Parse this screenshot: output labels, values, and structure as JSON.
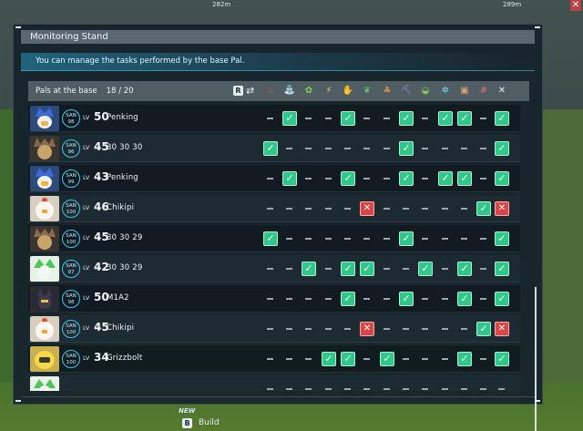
{
  "hud": {
    "distance_left": "282m",
    "distance_right": "289m",
    "close_glyph": "✕"
  },
  "window": {
    "title": "Monitoring Stand",
    "subtitle": "You can manage the tasks performed by the base Pal."
  },
  "list": {
    "title": "Pals at the base",
    "count": "18 / 20",
    "sort_key": "R",
    "swap_glyph": "⇄"
  },
  "work_icons": [
    {
      "name": "kindling-icon",
      "glyph": "♨",
      "color": "#e25a4a"
    },
    {
      "name": "watering-icon",
      "glyph": "⛲",
      "color": "#4ab8e8"
    },
    {
      "name": "planting-icon",
      "glyph": "✿",
      "color": "#7ccf4a"
    },
    {
      "name": "electricity-icon",
      "glyph": "⚡",
      "color": "#f2d23a"
    },
    {
      "name": "handiwork-icon",
      "glyph": "✋",
      "color": "#f0c070"
    },
    {
      "name": "gathering-icon",
      "glyph": "❦",
      "color": "#5ac86a"
    },
    {
      "name": "lumbering-icon",
      "glyph": "♣",
      "color": "#c88a4a"
    },
    {
      "name": "mining-icon",
      "glyph": "⛏",
      "color": "#8a9ac8"
    },
    {
      "name": "medicine-icon",
      "glyph": "◒",
      "color": "#8ac84a"
    },
    {
      "name": "cooling-icon",
      "glyph": "✲",
      "color": "#7ad8f0"
    },
    {
      "name": "transporting-icon",
      "glyph": "▣",
      "color": "#d8a070"
    },
    {
      "name": "farming-icon",
      "glyph": "#",
      "color": "#e07070"
    },
    {
      "name": "ignore-icon",
      "glyph": "✕",
      "color": "#e8eef0"
    }
  ],
  "pals": [
    {
      "name": "Penking",
      "lv_label": "LV",
      "level": "50",
      "san_label": "SAN",
      "san": "98",
      "avatar": "penking",
      "tasks": [
        "dash",
        "check",
        "dash",
        "dash",
        "check",
        "dash",
        "dash",
        "check",
        "dash",
        "check",
        "check",
        "dash",
        "check"
      ]
    },
    {
      "name": "30 30 30",
      "lv_label": "LV",
      "level": "45",
      "san_label": "SAN",
      "san": "96",
      "avatar": "antler",
      "tasks": [
        "check",
        "dash",
        "dash",
        "dash",
        "dash",
        "dash",
        "dash",
        "check",
        "dash",
        "dash",
        "dash",
        "dash",
        "check"
      ]
    },
    {
      "name": "Penking",
      "lv_label": "LV",
      "level": "43",
      "san_label": "SAN",
      "san": "99",
      "avatar": "penking",
      "tasks": [
        "dash",
        "check",
        "dash",
        "dash",
        "check",
        "dash",
        "dash",
        "check",
        "dash",
        "check",
        "check",
        "dash",
        "check"
      ]
    },
    {
      "name": "Chikipi",
      "lv_label": "LV",
      "level": "46",
      "san_label": "SAN",
      "san": "100",
      "avatar": "chikipi",
      "tasks": [
        "dash",
        "dash",
        "dash",
        "dash",
        "dash",
        "cross",
        "dash",
        "dash",
        "dash",
        "dash",
        "dash",
        "check",
        "cross"
      ]
    },
    {
      "name": "30 30 29",
      "lv_label": "LV",
      "level": "45",
      "san_label": "SAN",
      "san": "100",
      "avatar": "antler",
      "tasks": [
        "check",
        "dash",
        "dash",
        "dash",
        "dash",
        "dash",
        "dash",
        "check",
        "dash",
        "dash",
        "dash",
        "dash",
        "check"
      ]
    },
    {
      "name": "30 30 29",
      "lv_label": "LV",
      "level": "42",
      "san_label": "SAN",
      "san": "97",
      "avatar": "green",
      "tasks": [
        "dash",
        "dash",
        "check",
        "dash",
        "check",
        "check",
        "dash",
        "dash",
        "check",
        "dash",
        "check",
        "dash",
        "check"
      ]
    },
    {
      "name": "M1A2",
      "lv_label": "LV",
      "level": "50",
      "san_label": "SAN",
      "san": "98",
      "avatar": "dark",
      "tasks": [
        "dash",
        "dash",
        "dash",
        "dash",
        "check",
        "dash",
        "dash",
        "check",
        "dash",
        "dash",
        "check",
        "dash",
        "check"
      ]
    },
    {
      "name": "Chikipi",
      "lv_label": "LV",
      "level": "45",
      "san_label": "SAN",
      "san": "100",
      "avatar": "chikipi",
      "tasks": [
        "dash",
        "dash",
        "dash",
        "dash",
        "dash",
        "cross",
        "dash",
        "dash",
        "dash",
        "dash",
        "dash",
        "check",
        "cross"
      ]
    },
    {
      "name": "Grizzbolt",
      "lv_label": "LV",
      "level": "34",
      "san_label": "SAN",
      "san": "100",
      "avatar": "yellow",
      "tasks": [
        "dash",
        "dash",
        "dash",
        "check",
        "check",
        "dash",
        "check",
        "dash",
        "dash",
        "dash",
        "check",
        "dash",
        "check"
      ]
    },
    {
      "name": "",
      "lv_label": "",
      "level": "",
      "san_label": "",
      "san": "",
      "avatar": "green",
      "tasks": [
        "dash",
        "dash",
        "dash",
        "dash",
        "dash",
        "dash",
        "dash",
        "dash",
        "dash",
        "dash",
        "dash",
        "dash",
        "dash"
      ]
    }
  ],
  "bottom_hud": {
    "new_tag": "NEW",
    "key": "B",
    "action": "Build"
  }
}
